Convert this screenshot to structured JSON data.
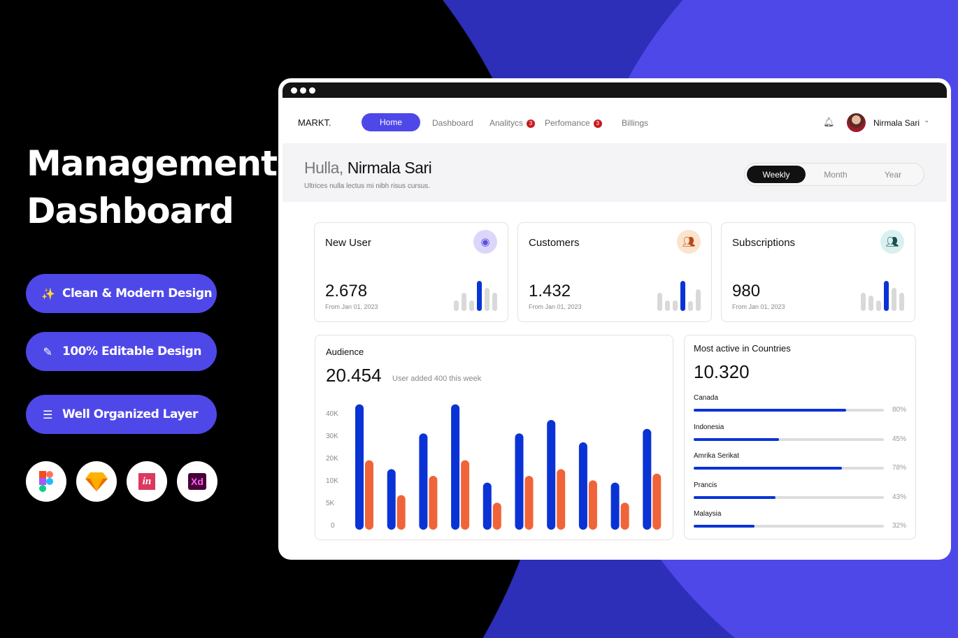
{
  "hero": {
    "line1": "Management",
    "line2": "Dashboard"
  },
  "features": [
    {
      "label": "Clean & Modern  Design",
      "icon": "magic-wand-icon"
    },
    {
      "label": "100% Editable Design",
      "icon": "pen-icon"
    },
    {
      "label": "Well Organized Layer",
      "icon": "layers-icon"
    }
  ],
  "tools": [
    {
      "name": "Figma",
      "icon": "figma-icon"
    },
    {
      "name": "Sketch",
      "icon": "sketch-icon"
    },
    {
      "name": "InVision",
      "icon": "invision-icon",
      "text": "in"
    },
    {
      "name": "Adobe XD",
      "icon": "xd-icon",
      "text": "Xd"
    }
  ],
  "app": {
    "logo": "MARKT.",
    "nav": [
      {
        "label": "Home",
        "active": true
      },
      {
        "label": "Dashboard"
      },
      {
        "label": "Analitycs",
        "badge": "3"
      },
      {
        "label": "Perfomance",
        "badge": "3"
      },
      {
        "label": "Billings"
      }
    ],
    "user": "Nirmala Sari"
  },
  "greeting": {
    "prefix": "Hulla,",
    "name": "Nirmala Sari",
    "subtitle": "Ultrices nulla lectus mi nibh risus cursus."
  },
  "periods": [
    {
      "label": "Weekly",
      "active": true
    },
    {
      "label": "Month"
    },
    {
      "label": "Year"
    }
  ],
  "stats": [
    {
      "title": "New User",
      "value": "2.678",
      "since": "From Jan 01, 2023",
      "icon": "user-circle-icon",
      "icon_bg": "#dcd6fb",
      "icon_color": "#5a4fe0",
      "mini": [
        0.35,
        0.6,
        0.34,
        1,
        0.76,
        0.6
      ]
    },
    {
      "title": "Customers",
      "value": "1.432",
      "since": "From Jan 01, 2023",
      "icon": "group-icon",
      "icon_bg": "#fbe3cc",
      "icon_color": "#b54a12",
      "mini": [
        0.6,
        0.34,
        0.34,
        1,
        0.32,
        0.72
      ]
    },
    {
      "title": "Subscriptions",
      "value": "980",
      "since": "From Jan 01, 2023",
      "icon": "team-icon",
      "icon_bg": "#d8f0f0",
      "icon_color": "#1d4e4e",
      "mini": [
        0.6,
        0.52,
        0.34,
        1,
        0.76,
        0.6
      ]
    }
  ],
  "audience": {
    "title": "Audience",
    "value": "20.454",
    "note": "User added 400 this week"
  },
  "chart_data": {
    "type": "bar",
    "y_ticks": [
      "0",
      "5K",
      "10K",
      "20K",
      "30K",
      "40K"
    ],
    "y_tick_values": [
      0,
      5000,
      10000,
      20000,
      30000,
      40000
    ],
    "colors": [
      "#0a33d6",
      "#f0643a"
    ],
    "series": [
      {
        "values": [
          42000,
          13000,
          29000,
          42000,
          8500,
          29000,
          35000,
          25000,
          8500,
          31000
        ]
      },
      {
        "values": [
          17000,
          5700,
          10000,
          17000,
          4000,
          10000,
          13000,
          9000,
          4000,
          11000
        ]
      }
    ]
  },
  "countries": {
    "title": "Most active in Countries",
    "value": "10.320",
    "items": [
      {
        "name": "Canada",
        "pct": 80
      },
      {
        "name": "Indonesia",
        "pct": 45
      },
      {
        "name": "Amrika Serikat",
        "pct": 78
      },
      {
        "name": "Prancis",
        "pct": 43
      },
      {
        "name": "Malaysia",
        "pct": 32
      }
    ]
  }
}
